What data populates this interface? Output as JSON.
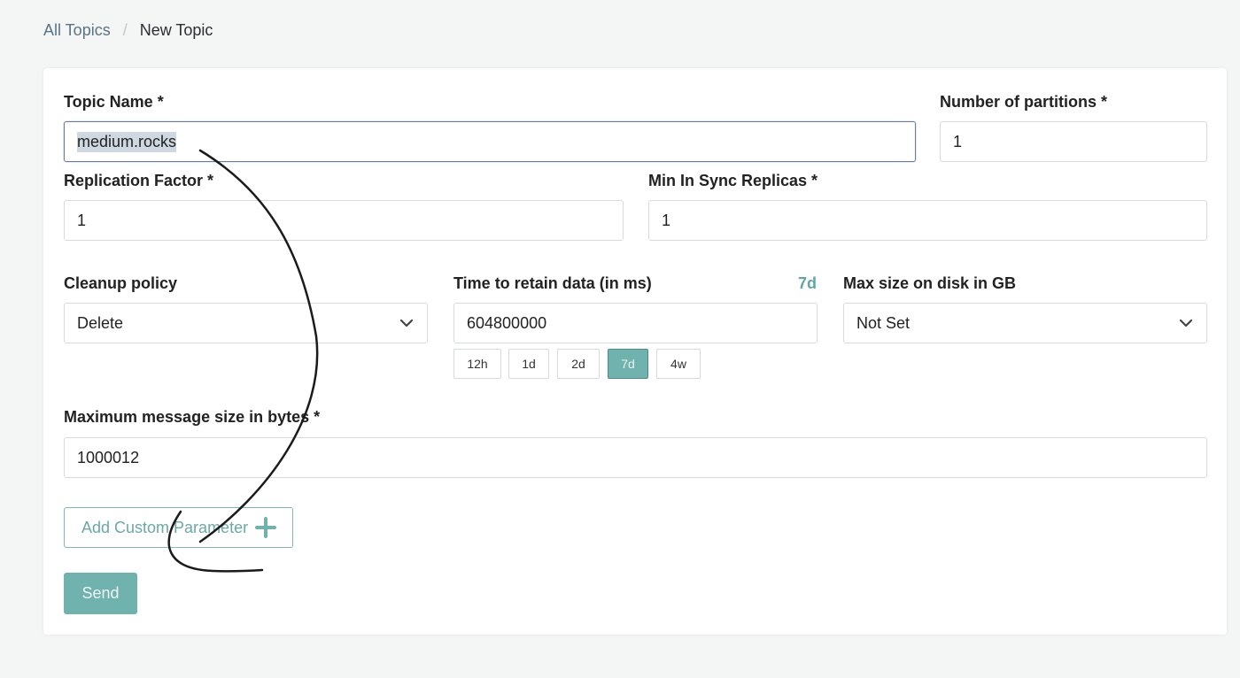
{
  "breadcrumb": {
    "parent": "All Topics",
    "separator": "/",
    "current": "New Topic"
  },
  "form": {
    "topic_name": {
      "label": "Topic Name *",
      "value": "medium.rocks"
    },
    "partitions": {
      "label": "Number of partitions *",
      "value": "1"
    },
    "replication_factor": {
      "label": "Replication Factor *",
      "value": "1"
    },
    "min_insync_replicas": {
      "label": "Min In Sync Replicas *",
      "value": "1"
    },
    "cleanup_policy": {
      "label": "Cleanup policy",
      "selected": "Delete",
      "icon": "chevron-down-icon"
    },
    "retention": {
      "label": "Time to retain data (in ms)",
      "hint": "7d",
      "value": "604800000",
      "presets": [
        "12h",
        "1d",
        "2d",
        "7d",
        "4w"
      ],
      "active_preset": "7d"
    },
    "max_disk_size": {
      "label": "Max size on disk in GB",
      "selected": "Not Set",
      "icon": "chevron-down-icon"
    },
    "max_message_size": {
      "label": "Maximum message size in bytes *",
      "value": "1000012"
    }
  },
  "actions": {
    "add_custom_parameter": "Add Custom Parameter",
    "add_icon": "plus-icon",
    "send": "Send"
  },
  "colors": {
    "accent": "#6fb2ae",
    "accent_text": "#6aa9a6",
    "link": "#5a7485",
    "background": "#f4f5f5"
  }
}
